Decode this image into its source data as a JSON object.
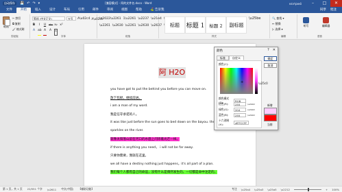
{
  "titlebar": {
    "autosave": "自动保存",
    "doc_title": "[兼容模式] - 阿的文件名.docx - Word",
    "user": "κεντρικό",
    "minimize": "–",
    "maximize": "□",
    "close": "✕",
    "qicons": [
      "💾",
      "↶",
      "↷",
      "▾"
    ]
  },
  "tabs": [
    "文件",
    "开始",
    "插入",
    "设计",
    "布局",
    "引用",
    "邮件",
    "审阅",
    "视图",
    "帮助",
    "⛳ 告诉我"
  ],
  "tabs_right": {
    "share": "同享",
    "comments": "批注"
  },
  "ribbon": {
    "paste": "粘贴",
    "cut": "✂ 剪切",
    "copy": "⧉ 复制",
    "format_painter": "🖌 格式刷",
    "clipboard": "剪贴板",
    "font_name": "等线 (中文正文)",
    "font_size": "五号",
    "font_group": "字体",
    "bold": "B",
    "italic": "I",
    "underline": "U",
    "strike": "abc",
    "sub": "x₂",
    "sup": "x²",
    "font_color_a": "A",
    "highlight": "ab",
    "clear": "A",
    "char_border": "A",
    "paragraph_group": "段落",
    "styles_group": "样式",
    "editing_group": "编辑",
    "styles": [
      "标题",
      "标题 1",
      "标题 2",
      "副标题"
    ],
    "find": "🔍 查找 ▾",
    "replace": "↔ 替换",
    "select": "▷ 选择 ▾",
    "dictate": "听写",
    "editor": "编辑器",
    "voice_group": "语音"
  },
  "colors": {
    "accent": "#2b579a",
    "font_red": "#c00000",
    "highlight_yellow": "#ffff00"
  },
  "document": {
    "heading": "阿 H2O",
    "lines": [
      "you have got to put the behind you before you can move on.",
      "放下包袱，继续前进。",
      "i am a man of my word.",
      "我是信守承诺的人。",
      "it was like just before the sun goes to bed down on the bayou. there",
      "sparkles on the river.",
      "就像太阳落山前在河口的水面上闪烁着光芒一样。",
      "if there is anything you need，  i will not be far away.",
      "只要你需要，我就在这里。",
      "we all have a destiny nothing just happens，it's all part of a plan.",
      "我们每个人都有自己的命运，没有什么是偶然发生的，一切都是命中注定的。"
    ]
  },
  "dialog": {
    "title": "颜色",
    "help": "?",
    "close": "✕",
    "tab_standard": "标准",
    "tab_custom": "自定义",
    "colors_label": "颜色(C):",
    "model_label": "颜色模式(D):",
    "model_value": "RGB",
    "red_label": "红色(R):",
    "red": "255",
    "green_label": "绿色(G):",
    "green": "204",
    "blue_label": "蓝色(B):",
    "blue": "255",
    "hex_label": "十六进制(H):",
    "hex": "#FFCCFF",
    "ok": "确定",
    "cancel": "取消",
    "new_label": "新增",
    "current_label": "当前",
    "new_color": "#ffccff",
    "current_color": "#ff0000"
  },
  "statusbar": {
    "page": "第 1 页，共 1 页",
    "words": "22/551 个字",
    "lang": "中文(中国)",
    "mode": "【辅助功能】",
    "focus": "专注",
    "zoom": "100%"
  }
}
